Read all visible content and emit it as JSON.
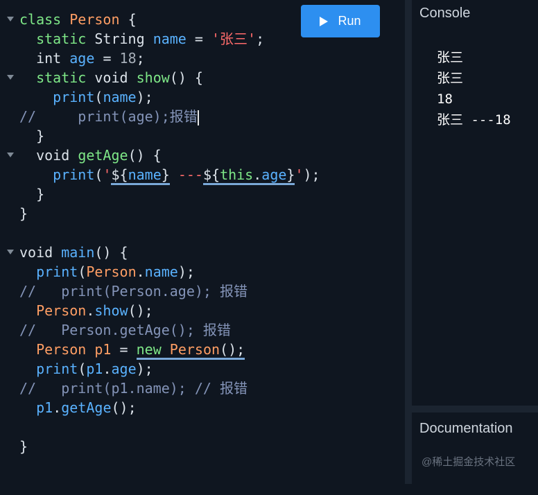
{
  "toolbar": {
    "run_label": "Run"
  },
  "console": {
    "title": "Console",
    "lines": [
      "张三",
      "张三",
      "18",
      "张三 ---18"
    ]
  },
  "documentation": {
    "title": "Documentation"
  },
  "watermark": "@稀土掘金技术社区",
  "code": {
    "l1": {
      "a": "class",
      "b": "Person",
      "c": "{"
    },
    "l2": {
      "a": "static",
      "b": "String",
      "c": "name",
      "d": "=",
      "e": "'张三'",
      "f": ";"
    },
    "l3": {
      "a": "int",
      "b": "age",
      "c": "=",
      "d": "18",
      "e": ";"
    },
    "l4": {
      "a": "static",
      "b": "void",
      "c": "show",
      "d": "() {"
    },
    "l5": {
      "a": "print",
      "b": "(",
      "c": "name",
      "d": ");"
    },
    "l6": {
      "a": "//     print(age);报错"
    },
    "l7": {
      "a": "}"
    },
    "l8": {
      "a": "void",
      "b": "getAge",
      "c": "() {"
    },
    "l9": {
      "a": "print",
      "b": "(",
      "c": "'",
      "d": "${",
      "e": "name",
      "f": "}",
      "g": " ---",
      "h": "${",
      "i": "this",
      "j": ".",
      "k": "age",
      "l": "}",
      "m": "'",
      "n": ");"
    },
    "l10": {
      "a": "}"
    },
    "l11": {
      "a": "}"
    },
    "l13": {
      "a": "void",
      "b": "main",
      "c": "() {"
    },
    "l14": {
      "a": "print",
      "b": "(",
      "c": "Person",
      "d": ".",
      "e": "name",
      "f": ");"
    },
    "l15": {
      "a": "//   print(Person.age); 报错"
    },
    "l16": {
      "a": "Person",
      "b": ".",
      "c": "show",
      "d": "();"
    },
    "l17": {
      "a": "//   Person.getAge(); 报错"
    },
    "l18": {
      "a": "Person",
      "b": "p1",
      "c": "=",
      "d": "new",
      "e": "Person",
      "f": "();"
    },
    "l19": {
      "a": "print",
      "b": "(",
      "c": "p1",
      "d": ".",
      "e": "age",
      "f": ");"
    },
    "l20": {
      "a": "//   print(p1.name); // 报错"
    },
    "l21": {
      "a": "p1",
      "b": ".",
      "c": "getAge",
      "d": "();"
    },
    "l23": {
      "a": "}"
    }
  }
}
